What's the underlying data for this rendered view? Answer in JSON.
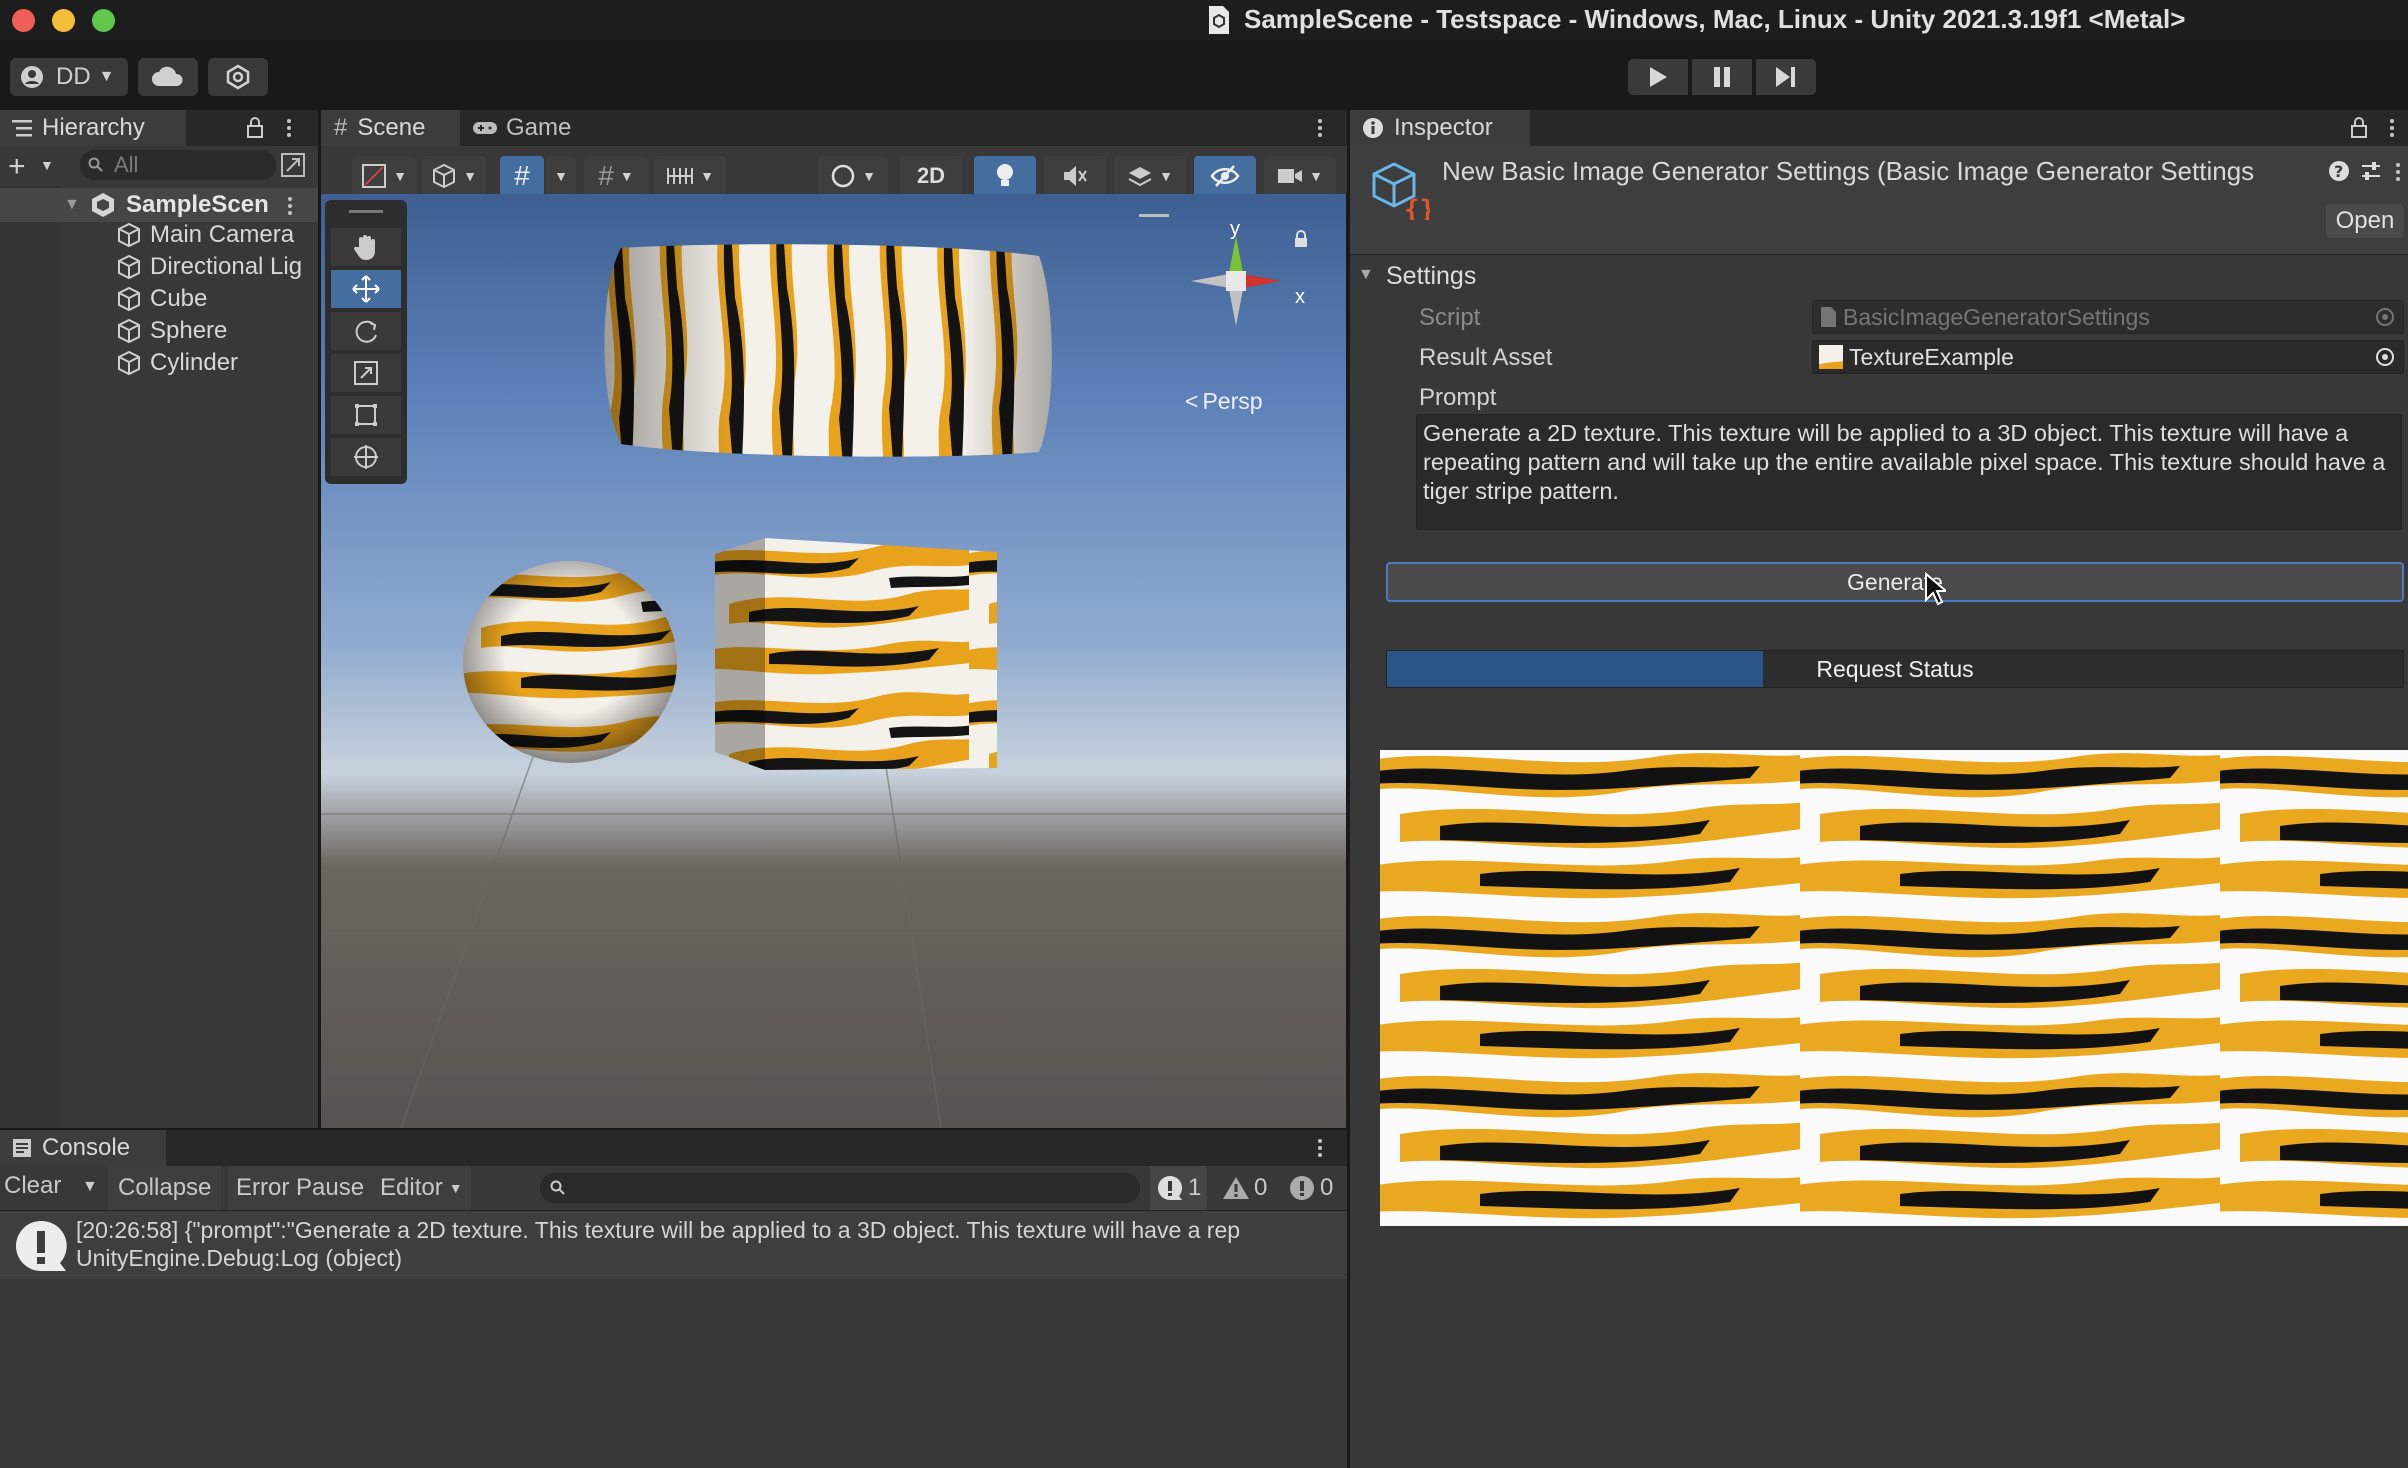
{
  "window": {
    "title": "SampleScene - Testspace - Windows, Mac, Linux - Unity 2021.3.19f1 <Metal>"
  },
  "toolbar": {
    "account_label": "DD"
  },
  "hierarchy": {
    "tab_label": "Hierarchy",
    "search_placeholder": "All",
    "scene_name": "SampleScen",
    "items": [
      {
        "label": "Main Camera"
      },
      {
        "label": "Directional Lig"
      },
      {
        "label": "Cube"
      },
      {
        "label": "Sphere"
      },
      {
        "label": "Cylinder"
      }
    ]
  },
  "scene": {
    "tab_scene": "Scene",
    "tab_game": "Game",
    "mode_2d": "2D",
    "projection_label": "Persp",
    "gizmo_y": "y",
    "gizmo_x": "x"
  },
  "inspector": {
    "tab_label": "Inspector",
    "asset_title": "New Basic Image Generator Settings (Basic Image Generator Settings",
    "open_button": "Open",
    "section": "Settings",
    "script_label": "Script",
    "script_value": "BasicImageGeneratorSettings",
    "result_label": "Result Asset",
    "result_value": "TextureExample",
    "prompt_label": "Prompt",
    "prompt_text": "Generate a 2D texture. This texture will be applied to a 3D object. This texture will have a repeating pattern and will take up the entire available pixel space. This texture should have a tiger stripe pattern.",
    "generate_button": "Generate",
    "request_status_label": "Request Status",
    "request_progress": 0.37
  },
  "console": {
    "tab_label": "Console",
    "clear": "Clear",
    "collapse": "Collapse",
    "error_pause": "Error Pause",
    "editor": "Editor",
    "count_info": "1",
    "count_warn": "0",
    "count_error": "0",
    "log_line1": "[20:26:58] {\"prompt\":\"Generate a 2D texture. This texture will be applied to a 3D object. This texture will have a rep",
    "log_line2": "UnityEngine.Debug:Log (object)"
  },
  "colors": {
    "accent_blue": "#4a7ac0",
    "progress_fill": "#2a5588",
    "tiger_orange": "#e8a21c",
    "tiger_black": "#141414"
  }
}
